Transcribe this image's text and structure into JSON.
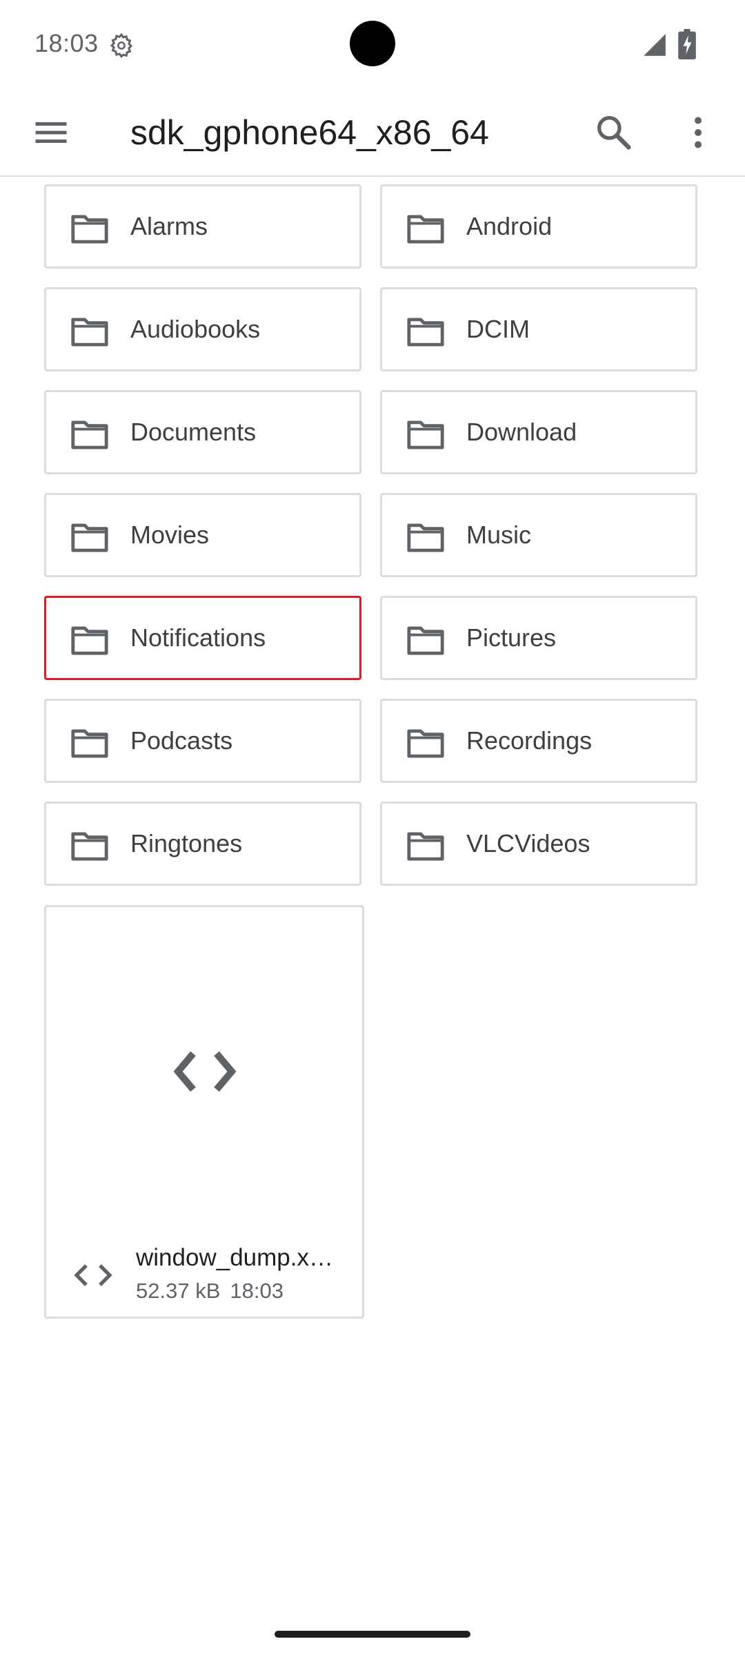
{
  "status_bar": {
    "time": "18:03"
  },
  "app_bar": {
    "title": "sdk_gphone64_x86_64",
    "icons": [
      "menu-icon",
      "search-icon",
      "more-vert-icon"
    ]
  },
  "folders": [
    {
      "label": "Alarms"
    },
    {
      "label": "Android"
    },
    {
      "label": "Audiobooks"
    },
    {
      "label": "DCIM"
    },
    {
      "label": "Documents"
    },
    {
      "label": "Download"
    },
    {
      "label": "Movies"
    },
    {
      "label": "Music"
    },
    {
      "label": "Notifications",
      "selected": true
    },
    {
      "label": "Pictures"
    },
    {
      "label": "Podcasts"
    },
    {
      "label": "Recordings"
    },
    {
      "label": "Ringtones"
    },
    {
      "label": "VLCVideos"
    }
  ],
  "file": {
    "name": "window_dump.x…",
    "size": "52.37 kB",
    "time": "18:03",
    "icon": "code-icon"
  },
  "colors": {
    "selection_border": "#e01b24",
    "card_border": "#dadce0",
    "icon_gray": "#5f6368"
  }
}
